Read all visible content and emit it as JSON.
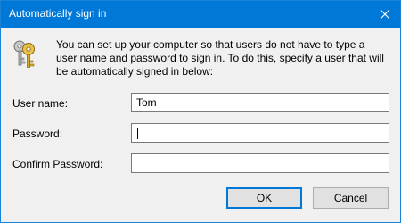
{
  "window": {
    "title": "Automatically sign in",
    "close_icon": "close-icon"
  },
  "intro": {
    "icon": "keys-icon",
    "text": "You can set up your computer so that users do not have to type a user name and password to sign in. To do this, specify a user that will be automatically signed in below:"
  },
  "form": {
    "username": {
      "label": "User name:",
      "value": "Tom"
    },
    "password": {
      "label": "Password:",
      "value": ""
    },
    "confirm_password": {
      "label": "Confirm Password:",
      "value": ""
    }
  },
  "buttons": {
    "ok": "OK",
    "cancel": "Cancel"
  },
  "colors": {
    "accent": "#0078d7",
    "dialog_bg": "#f0f0f0"
  }
}
